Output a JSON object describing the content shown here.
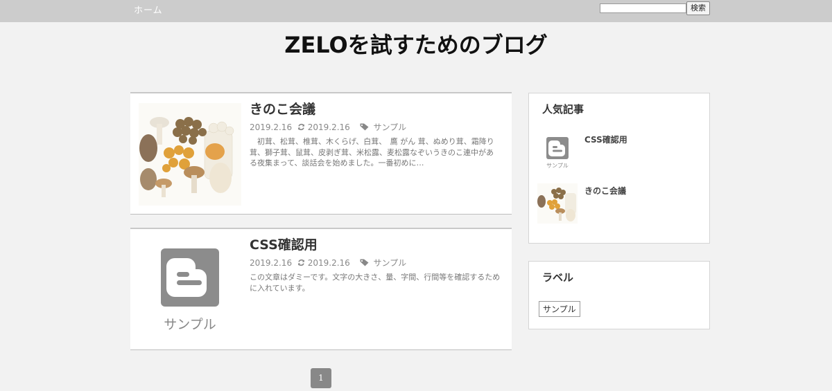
{
  "nav": {
    "home_label": "ホーム"
  },
  "search": {
    "value": "",
    "placeholder": "",
    "button_label": "検索"
  },
  "site": {
    "title": "ZELOを試すためのブログ"
  },
  "posts": [
    {
      "title": "きのこ会議",
      "published": "2019.2.16",
      "updated": "2019.2.16",
      "label": "サンプル",
      "excerpt": "　初茸、松茸、椎茸、木くらげ、白茸、　鷹 がん 茸、ぬめり茸、霜降り茸、獅子茸、鼠茸、皮剥ぎ茸、米松露、麦松露なぞいうきのこ連中がある夜集まって、談話会を始めました。一番初めに…",
      "thumb_icon": "mushroom-photo"
    },
    {
      "title": "CSS確認用",
      "published": "2019.2.16",
      "updated": "2019.2.16",
      "label": "サンプル",
      "excerpt": "この文章はダミーです。文字の大きさ、量、字間、行間等を確認するために入れています。",
      "thumb_icon": "blogger-icon",
      "thumb_caption": "サンプル"
    }
  ],
  "sidebar": {
    "popular": {
      "title": "人気記事",
      "items": [
        {
          "title": "CSS確認用",
          "thumb_icon": "blogger-icon",
          "thumb_caption": "サンプル"
        },
        {
          "title": "きのこ会議",
          "thumb_icon": "mushroom-photo"
        }
      ]
    },
    "labels": {
      "title": "ラベル",
      "items": [
        {
          "label": "サンプル"
        }
      ]
    }
  },
  "pagination": {
    "current": "1"
  },
  "colors": {
    "background": "#f2f2f2",
    "topbar": "#cccccc",
    "meta_text": "#888888",
    "page_button": "#888888"
  }
}
